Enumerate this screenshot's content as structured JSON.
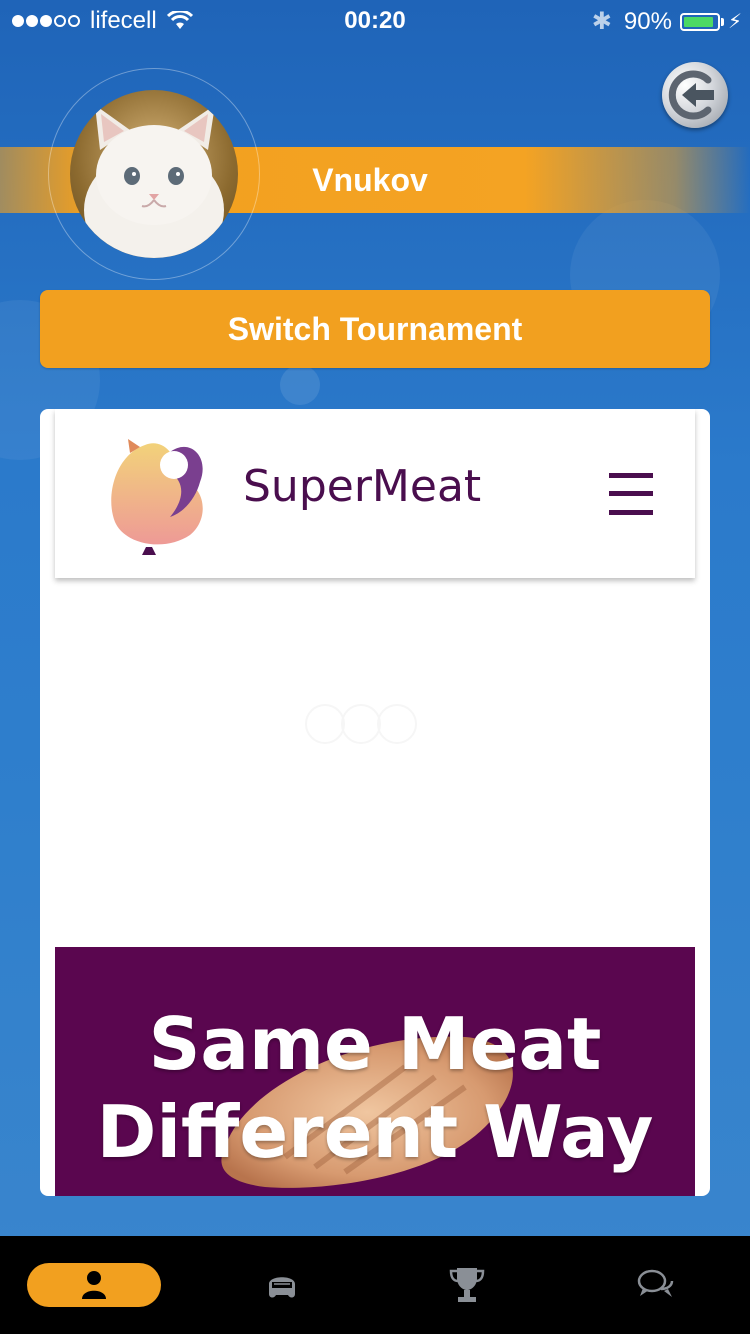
{
  "status_bar": {
    "carrier": "lifecell",
    "time": "00:20",
    "battery": "90%"
  },
  "profile": {
    "user_name": "Vnukov"
  },
  "switch_tournament_label": "Switch Tournament",
  "site": {
    "title": "SuperMeat",
    "banner_line1": "Same Meat",
    "banner_line2": "Different Way"
  },
  "tabs": [
    {
      "icon": "user-icon",
      "active": true
    },
    {
      "icon": "helmet-icon",
      "active": false
    },
    {
      "icon": "trophy-icon",
      "active": false
    },
    {
      "icon": "chat-icon",
      "active": false
    }
  ],
  "colors": {
    "accent": "#f2a01f",
    "brand_purple": "#4a0e4e",
    "banner_bg": "#5a064f",
    "battery_green": "#4cd964"
  }
}
